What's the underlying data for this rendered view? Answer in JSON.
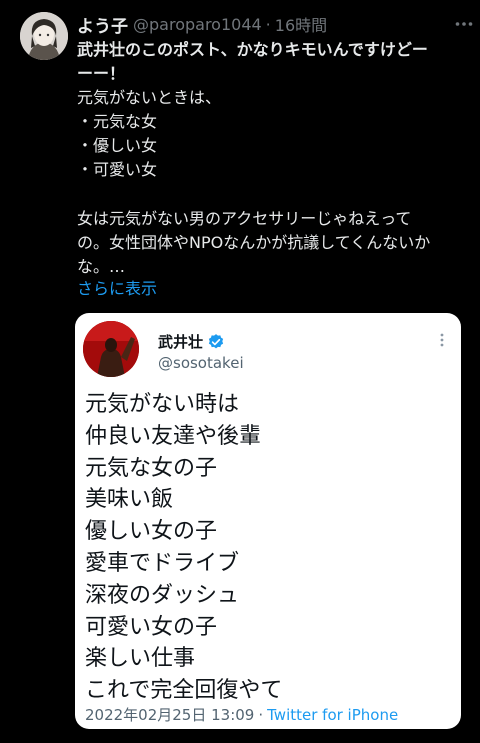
{
  "tweet": {
    "author_name": "よう子",
    "handle": "@paroparo1044",
    "separator": "·",
    "time": "16時間",
    "lines": [
      "武井壮のこのポスト、かなりキモいんですけどー",
      "ーー！",
      "元気がないときは、",
      "・元気な女",
      "・優しい女",
      "・可愛い女",
      "",
      "女は元気がない男のアクセサリーじゃねえって",
      "の。女性団体やNPOなんかが抗議してくんないか",
      "な。…"
    ],
    "show_more": "さらに表示"
  },
  "quoted": {
    "author_name": "武井壮",
    "handle": "@sosotakei",
    "lines": [
      "元気がない時は",
      "仲良い友達や後輩",
      "元気な女の子",
      "美味い飯",
      "優しい女の子",
      "愛車でドライブ",
      "深夜のダッシュ",
      "可愛い女の子",
      "楽しい仕事",
      "これで完全回復やて"
    ],
    "date": "2022年02月25日 13:09",
    "separator": "·",
    "source": "Twitter for iPhone"
  },
  "colors": {
    "background": "#000000",
    "text": "#e7e9ea",
    "secondary": "#71767b",
    "link": "#1d9bf0",
    "verified": "#1d9bf0"
  },
  "icons": {
    "more": "more-horizontal-icon",
    "quoted_more": "more-vertical-icon",
    "verified": "verified-badge-icon"
  }
}
